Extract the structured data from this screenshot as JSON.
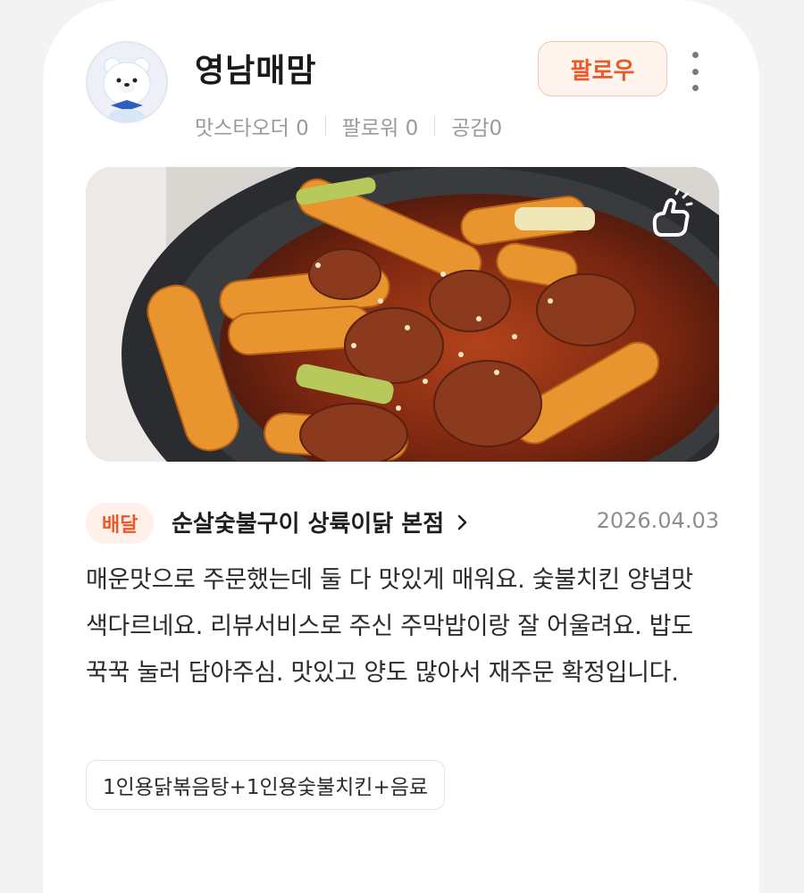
{
  "profile": {
    "username": "영남매맘",
    "follow_label": "팔로우",
    "stats": [
      {
        "label": "맛스타오더",
        "value": "0"
      },
      {
        "label": "팔로워",
        "value": "0"
      },
      {
        "label": "공감",
        "value": "0"
      }
    ],
    "more_icon": "more-vertical-icon"
  },
  "photo": {
    "like_icon": "thumbs-up-icon"
  },
  "order": {
    "type_badge": "배달",
    "store_name": "순살숯불구이 상륙이닭 본점",
    "date": "2026.04.03"
  },
  "review": {
    "text": "매운맛으로 주문했는데 둘 다 맛있게 매워요. 숯불치킨 양념맛 색다르네요. 리뷰서비스로 주신 주막밥이랑 잘 어울려요. 밥도 꾹꾹 눌러 담아주심. 맛있고 양도 많아서 재주문 확정입니다."
  },
  "menu": {
    "items_text": "1인용닭볶음탕+1인용숯불치킨+음료"
  },
  "colors": {
    "accent": "#ea5b2b",
    "accent_bg": "#fff0e9"
  }
}
